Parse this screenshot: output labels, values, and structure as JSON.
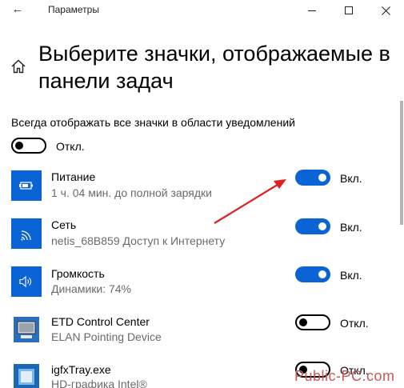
{
  "window": {
    "title": "Параметры",
    "back_icon": "arrow-left-icon",
    "controls": [
      "minimize-icon",
      "maximize-icon",
      "close-icon"
    ]
  },
  "page": {
    "title": "Выберите значки, отображаемые в панели задач",
    "home_icon": "home-icon"
  },
  "always_show": {
    "label": "Всегда отображать все значки в области уведомлений",
    "state": "off",
    "state_label": "Откл."
  },
  "items": [
    {
      "name": "Питание",
      "subtitle": "1 ч. 04 мин. до полной зарядки",
      "icon": "battery-icon",
      "state": "on",
      "state_label": "Вкл."
    },
    {
      "name": "Сеть",
      "subtitle": "netis_68B859 Доступ к Интернету",
      "icon": "wifi-icon",
      "state": "on",
      "state_label": "Вкл."
    },
    {
      "name": "Громкость",
      "subtitle": "Динамики: 74%",
      "icon": "speaker-icon",
      "state": "on",
      "state_label": "Вкл."
    },
    {
      "name": "ETD Control Center",
      "subtitle": "ELAN Pointing Device",
      "icon": "touchpad-icon",
      "state": "off",
      "state_label": "Откл."
    },
    {
      "name": "igfxTray.exe",
      "subtitle": "HD-графика Intel®",
      "icon": "intel-graphics-icon",
      "state": "off",
      "state_label": "Откл."
    }
  ],
  "annotation": {
    "arrow_color": "#e02020"
  },
  "watermark": "Public-PC.com",
  "colors": {
    "accent": "#0a64d6",
    "text": "#000000",
    "subtext": "#6a6a6a"
  }
}
